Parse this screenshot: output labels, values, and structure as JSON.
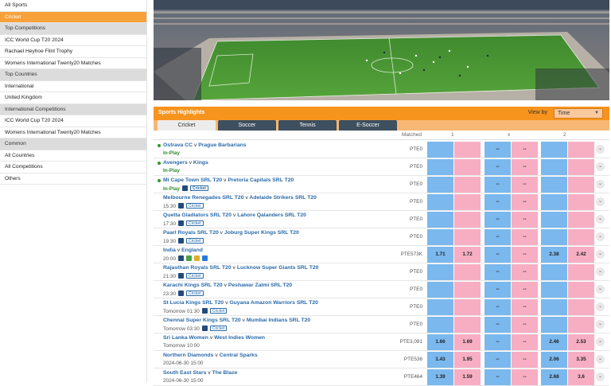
{
  "sidebar": {
    "items": [
      {
        "label": "All Sports",
        "kind": "link"
      },
      {
        "label": "Cricket",
        "kind": "active"
      },
      {
        "label": "Top Competitions",
        "kind": "head"
      },
      {
        "label": "ICC World Cup T20 2024",
        "kind": "link"
      },
      {
        "label": "Rachael Heyhoe Flint Trophy",
        "kind": "link"
      },
      {
        "label": "Womens International Twenty20 Matches",
        "kind": "link"
      },
      {
        "label": "Top Countries",
        "kind": "head"
      },
      {
        "label": "International",
        "kind": "link"
      },
      {
        "label": "United Kingdom",
        "kind": "link"
      },
      {
        "label": "International Competitions",
        "kind": "head"
      },
      {
        "label": "ICC World Cup T20 2024",
        "kind": "link"
      },
      {
        "label": "Womens International Twenty20 Matches",
        "kind": "link"
      },
      {
        "label": "Common",
        "kind": "head"
      },
      {
        "label": "All Countries",
        "kind": "link"
      },
      {
        "label": "All Competitions",
        "kind": "link"
      },
      {
        "label": "Others",
        "kind": "link"
      }
    ]
  },
  "highlights": {
    "title": "Sports Highlights",
    "view_by_label": "View by",
    "view_by_value": "Time",
    "tabs": [
      "Cricket",
      "Soccer",
      "Tennis",
      "E-Soccer"
    ],
    "active_tab": 0,
    "columns": {
      "matched": "Matched",
      "home": "1",
      "draw": "x",
      "away": "2"
    }
  },
  "events": [
    {
      "home": "Ostrava CC",
      "away": "Prague Barbarians",
      "sub": "In-Play",
      "live": true,
      "badges": [],
      "matched": "PTE0",
      "odds": [
        "",
        "",
        "--",
        "--",
        "",
        ""
      ]
    },
    {
      "home": "Avengers",
      "away": "Kings",
      "sub": "In-Play",
      "live": true,
      "badges": [],
      "matched": "PTE0",
      "odds": [
        "",
        "",
        "--",
        "--",
        "",
        ""
      ]
    },
    {
      "home": "Mi Cape Town SRL T20",
      "away": "Pretoria Capitals SRL T20",
      "sub": "In-Play",
      "live": true,
      "badges": [
        "Cricket"
      ],
      "matched": "PTE0",
      "odds": [
        "",
        "",
        "--",
        "--",
        "",
        ""
      ]
    },
    {
      "home": "Melbourne Renegades SRL T20",
      "away": "Adelaide Strikers SRL T20",
      "sub": "15:30",
      "live": false,
      "badges": [
        "Cricket"
      ],
      "matched": "PTE0",
      "odds": [
        "",
        "",
        "--",
        "--",
        "",
        ""
      ]
    },
    {
      "home": "Quetta Gladiators SRL T20",
      "away": "Lahore Qalanders SRL T20",
      "sub": "17:30",
      "live": false,
      "badges": [
        "Cricket"
      ],
      "matched": "PTE0",
      "odds": [
        "",
        "",
        "--",
        "--",
        "",
        ""
      ]
    },
    {
      "home": "Paarl Royals SRL T20",
      "away": "Joburg Super Kings SRL T20",
      "sub": "19:30",
      "live": false,
      "badges": [
        "Cricket"
      ],
      "matched": "PTE0",
      "odds": [
        "",
        "",
        "--",
        "--",
        "",
        ""
      ]
    },
    {
      "home": "India",
      "away": "England",
      "sub": "20:00",
      "live": false,
      "badges": [
        "icons"
      ],
      "matched": "PTE573K",
      "odds": [
        "1.71",
        "1.72",
        "--",
        "--",
        "2.38",
        "2.42"
      ]
    },
    {
      "home": "Rajasthan Royals SRL T20",
      "away": "Lucknow Super Giants SRL T20",
      "sub": "21:30",
      "live": false,
      "badges": [
        "Cricket"
      ],
      "matched": "PTE0",
      "odds": [
        "",
        "",
        "--",
        "--",
        "",
        ""
      ]
    },
    {
      "home": "Karachi Kings SRL T20",
      "away": "Peshawar Zalmi SRL T20",
      "sub": "23:30",
      "live": false,
      "badges": [
        "Cricket"
      ],
      "matched": "PTE0",
      "odds": [
        "",
        "",
        "--",
        "--",
        "",
        ""
      ]
    },
    {
      "home": "St Lucia Kings SRL T20",
      "away": "Guyana Amazon Warriors SRL T20",
      "sub": "Tomorrow 01:30",
      "live": false,
      "badges": [
        "Cricket"
      ],
      "matched": "PTE0",
      "odds": [
        "",
        "",
        "--",
        "--",
        "",
        ""
      ]
    },
    {
      "home": "Chennai Super Kings SRL T20",
      "away": "Mumbai Indians SRL T20",
      "sub": "Tomorrow 03:30",
      "live": false,
      "badges": [
        "Cricket"
      ],
      "matched": "PTE0",
      "odds": [
        "",
        "",
        "--",
        "--",
        "",
        ""
      ]
    },
    {
      "home": "Sri Lanka Women",
      "away": "West Indies Women",
      "sub": "Tomorrow 10:00",
      "live": false,
      "badges": [],
      "matched": "PTE3,091",
      "odds": [
        "1.66",
        "1.69",
        "--",
        "--",
        "2.46",
        "2.53"
      ]
    },
    {
      "home": "Northern Diamonds",
      "away": "Central Sparks",
      "sub": "2024-06-30 15:00",
      "live": false,
      "badges": [],
      "matched": "PTE536",
      "odds": [
        "1.43",
        "1.95",
        "--",
        "--",
        "2.06",
        "3.35"
      ]
    },
    {
      "home": "South East Stars",
      "away": "The Blaze",
      "sub": "2024-06-30 15:00",
      "live": false,
      "badges": [],
      "matched": "PTE464",
      "odds": [
        "1.39",
        "1.59",
        "--",
        "--",
        "2.68",
        "3.6"
      ]
    }
  ],
  "separator": "v",
  "more_icon": "chevron-down-icon",
  "colors": {
    "accent": "#f7941d",
    "back": "#7ab8ee",
    "lay": "#f7aec3",
    "tab_dark": "#3e4f5f",
    "live": "#2c9a2c"
  }
}
